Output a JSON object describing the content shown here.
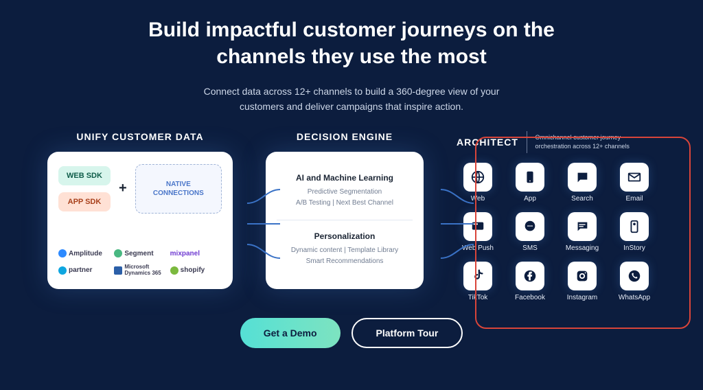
{
  "hero": {
    "title_line1": "Build impactful customer journeys on the",
    "title_line2": "channels they use the most",
    "subtitle_line1": "Connect data across 12+ channels to build a 360-degree view of your",
    "subtitle_line2": "customers and deliver campaigns that inspire action."
  },
  "unify": {
    "header": "UNIFY CUSTOMER DATA",
    "web_sdk": "WEB SDK",
    "app_sdk": "APP SDK",
    "plus": "+",
    "native": "NATIVE\nCONNECTIONS",
    "logos": {
      "amplitude": "Amplitude",
      "segment": "Segment",
      "mixpanel": "mixpanel",
      "salesforce": "partner",
      "dynamics": "Microsoft\nDynamics 365",
      "shopify": "shopify"
    }
  },
  "decision": {
    "header": "DECISION ENGINE",
    "ai_title": "AI and Machine Learning",
    "ai_line1": "Predictive Segmentation",
    "ai_line2": "A/B Testing | Next Best Channel",
    "pers_title": "Personalization",
    "pers_line1": "Dynamic content | Template Library",
    "pers_line2": "Smart Recommendations"
  },
  "architect": {
    "title": "ARCHITECT",
    "desc": "Omnichannel customer journey orchestration across 12+ channels",
    "channels": {
      "web": "Web",
      "app": "App",
      "search": "Search",
      "email": "Email",
      "webpush": "Web Push",
      "sms": "SMS",
      "messaging": "Messaging",
      "instory": "InStory",
      "tiktok": "TikTok",
      "facebook": "Facebook",
      "instagram": "Instagram",
      "whatsapp": "WhatsApp"
    }
  },
  "cta": {
    "demo": "Get a Demo",
    "tour": "Platform Tour"
  }
}
